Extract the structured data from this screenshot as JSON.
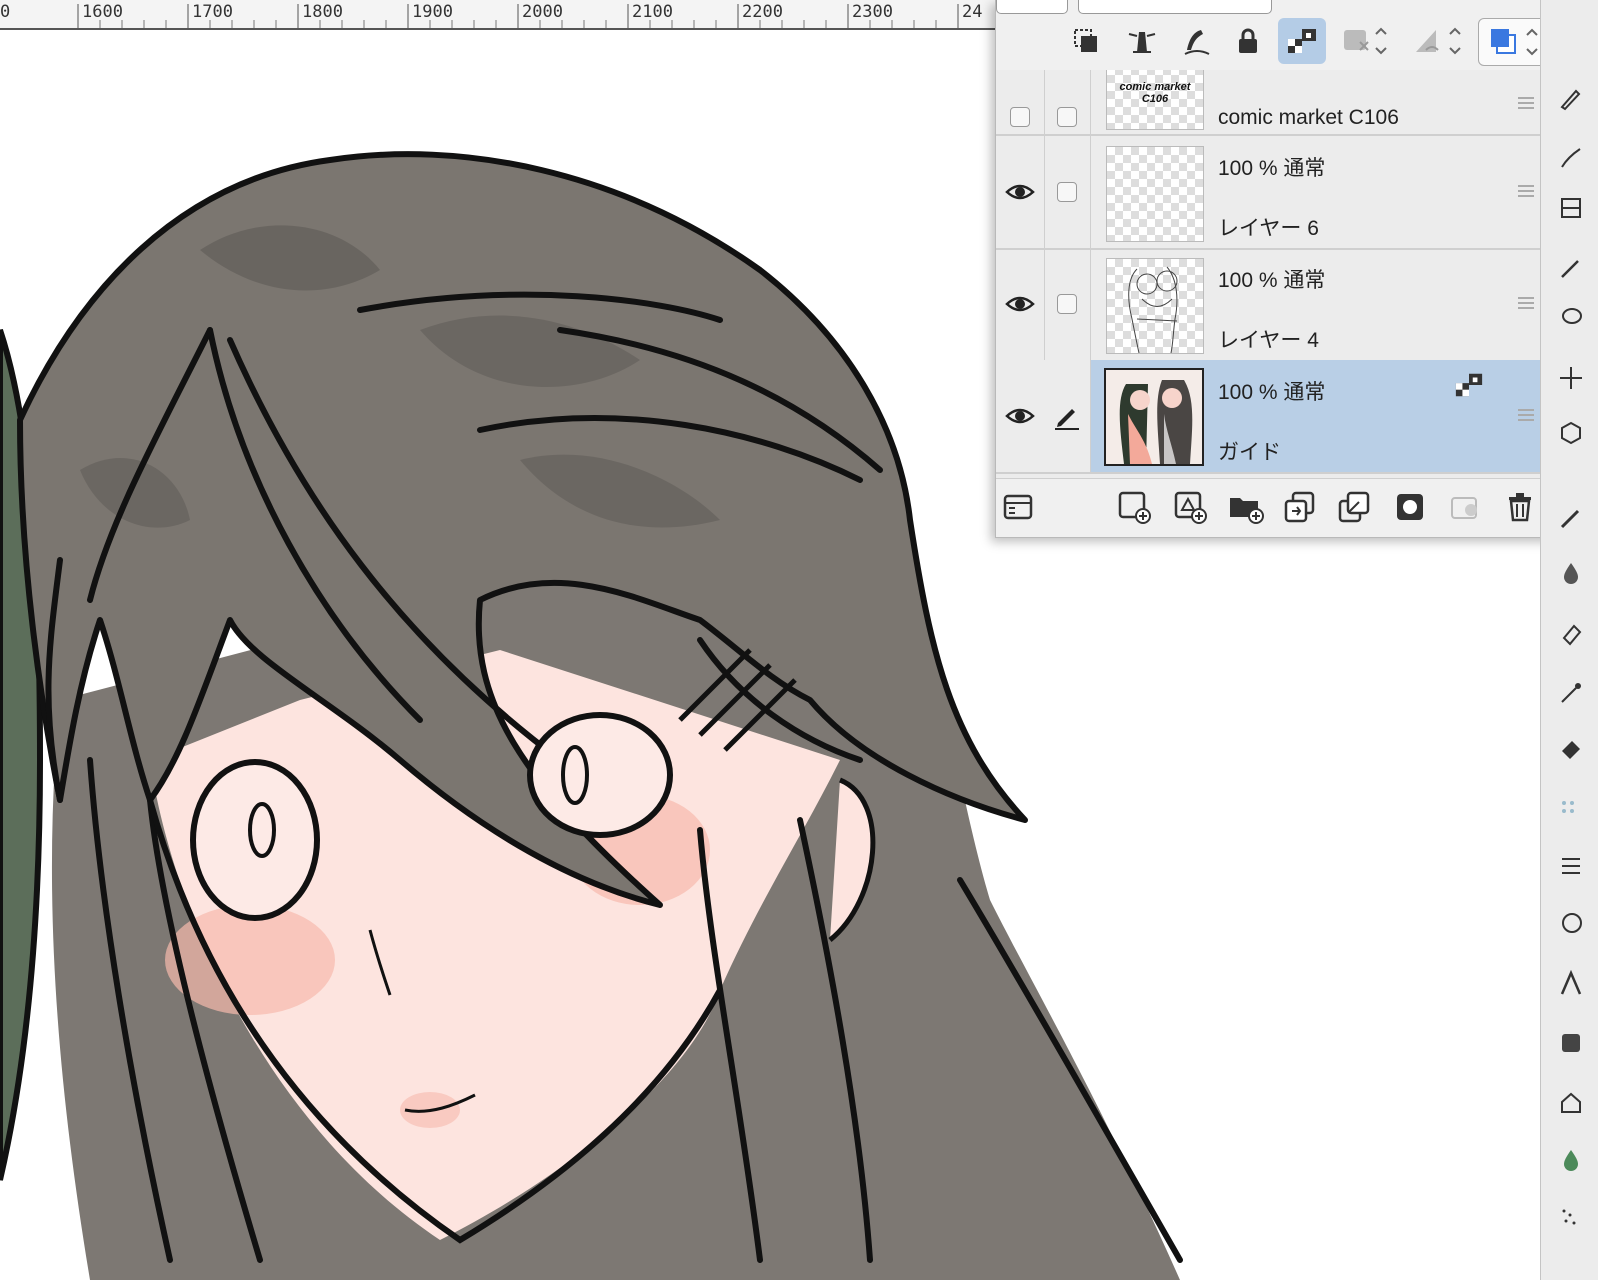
{
  "ruler": {
    "labels": [
      "0",
      "1600",
      "1700",
      "1800",
      "1900",
      "2000",
      "2100",
      "2200",
      "2300",
      "24"
    ]
  },
  "layer_panel": {
    "layers": [
      {
        "opacity_blend": "",
        "name": "comic market C106",
        "thumb_text": "comic market C106",
        "visible": false,
        "selected": false
      },
      {
        "opacity_blend": "100 % 通常",
        "name": "レイヤー 6",
        "visible": true,
        "selected": false
      },
      {
        "opacity_blend": "100 % 通常",
        "name": "レイヤー 4",
        "visible": true,
        "selected": false
      },
      {
        "opacity_blend": "100 % 通常",
        "name": "ガイド",
        "visible": true,
        "selected": true
      }
    ],
    "colors": {
      "selected_row": "#b9cfe6",
      "active_tool": "#b4cce6",
      "accent": "#3a78e0"
    },
    "toolbar_icons": [
      "clip-layer-icon",
      "lighthouse-reference-icon",
      "draft-layer-icon",
      "lock-icon",
      "lock-transparency-icon",
      "mask-icon",
      "palette-icon",
      "color-icon"
    ],
    "bottom_icons": [
      "layer-property-icon",
      "new-raster-layer-icon",
      "new-vector-layer-icon",
      "new-folder-icon",
      "duplicate-layer-icon",
      "merge-layer-icon",
      "mask-icon",
      "camera-layer-icon",
      "trash-icon"
    ]
  }
}
